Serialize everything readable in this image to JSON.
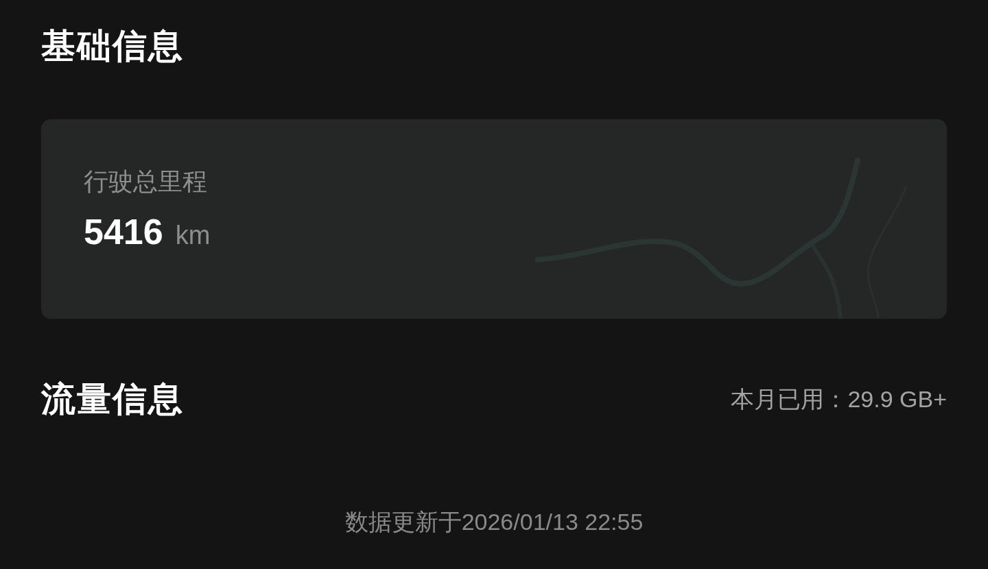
{
  "basic_info": {
    "title": "基础信息",
    "mileage_card": {
      "label": "行驶总里程",
      "value": "5416",
      "unit": "km"
    }
  },
  "traffic_info": {
    "title": "流量信息",
    "used_this_month": "本月已用：29.9 GB+"
  },
  "footer": {
    "updated": "数据更新于2026/01/13 22:55"
  }
}
